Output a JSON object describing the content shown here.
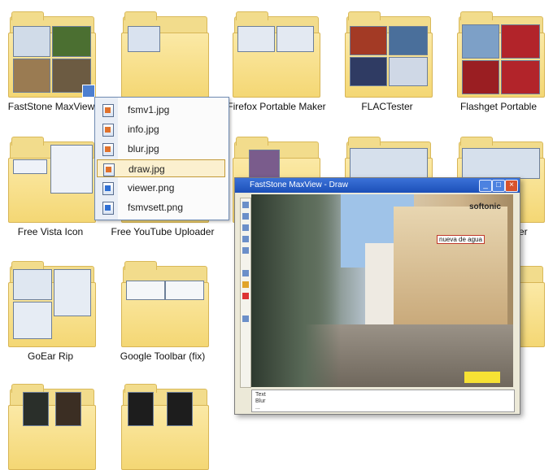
{
  "folders": [
    {
      "label": "FastStone MaxView"
    },
    {
      "label": ""
    },
    {
      "label": "Firefox Portable Maker"
    },
    {
      "label": "FLACTester"
    },
    {
      "label": "Flashget Portable"
    },
    {
      "label": "Free Vista Icon"
    },
    {
      "label": "Free YouTube Uploader"
    },
    {
      "label": ""
    },
    {
      "label": ""
    },
    {
      "label": "er"
    },
    {
      "label": "GoEar Rip"
    },
    {
      "label": "Google Toolbar (fix)"
    }
  ],
  "context_menu": {
    "items": [
      {
        "label": "fsmv1.jpg",
        "type": "jpg"
      },
      {
        "label": "info.jpg",
        "type": "jpg"
      },
      {
        "label": "blur.jpg",
        "type": "jpg"
      },
      {
        "label": "draw.jpg",
        "type": "jpg",
        "selected": true
      },
      {
        "label": "viewer.png",
        "type": "png"
      },
      {
        "label": "fsmvsett.png",
        "type": "png"
      }
    ]
  },
  "preview": {
    "title": "FastStone MaxView - Draw",
    "watermark": "softonic",
    "tag": "nueva de agua",
    "status_lines": [
      "Text",
      "Blur",
      "..."
    ]
  },
  "icons": [
    "download-arrow-icon",
    "jpg-file-icon",
    "png-file-icon",
    "minimize-icon",
    "maximize-icon",
    "close-icon"
  ]
}
